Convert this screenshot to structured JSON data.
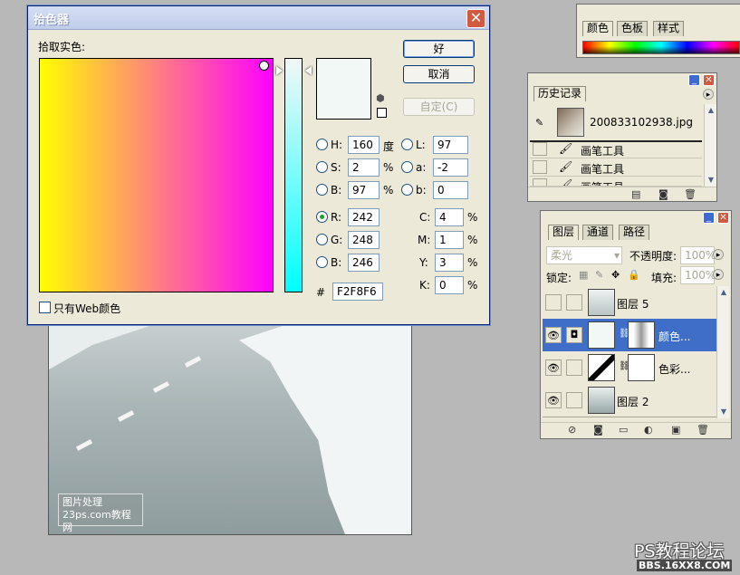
{
  "picker": {
    "title": "拾色器",
    "subtitle": "拾取实色:",
    "buttons": {
      "ok": "好",
      "cancel": "取消",
      "custom": "自定(C)"
    },
    "hsb": [
      {
        "label": "H:",
        "value": "160",
        "unit": "度",
        "selected": false
      },
      {
        "label": "S:",
        "value": "2",
        "unit": "%",
        "selected": false
      },
      {
        "label": "B:",
        "value": "97",
        "unit": "%",
        "selected": false
      }
    ],
    "lab": [
      {
        "label": "L:",
        "value": "97"
      },
      {
        "label": "a:",
        "value": "-2"
      },
      {
        "label": "b:",
        "value": "0"
      }
    ],
    "rgb": [
      {
        "label": "R:",
        "value": "242",
        "selected": true
      },
      {
        "label": "G:",
        "value": "248",
        "selected": false
      },
      {
        "label": "B:",
        "value": "246",
        "selected": false
      }
    ],
    "cmyk": [
      {
        "label": "C:",
        "value": "4",
        "unit": "%"
      },
      {
        "label": "M:",
        "value": "1",
        "unit": "%"
      },
      {
        "label": "Y:",
        "value": "3",
        "unit": "%"
      },
      {
        "label": "K:",
        "value": "0",
        "unit": "%"
      }
    ],
    "hex_label": "#",
    "hex": "F2F8F6",
    "web_only": "只有Web颜色",
    "current_color": "#f2f8f6"
  },
  "color_panel": {
    "tabs": [
      "颜色",
      "色板",
      "样式"
    ]
  },
  "history_panel": {
    "tab": "历史记录",
    "snapshot": "200833102938.jpg",
    "items": [
      "画笔工具",
      "画笔工具",
      "画笔工具"
    ]
  },
  "layers_panel": {
    "tabs": [
      "图层",
      "通道",
      "路径"
    ],
    "blend_mode": "柔光",
    "opacity_label": "不透明度:",
    "opacity": "100%",
    "lock_label": "锁定:",
    "fill_label": "填充:",
    "fill": "100%",
    "layers": [
      "图层 5",
      "颜色...",
      "色彩...",
      "图层 2"
    ]
  },
  "watermark": {
    "line1": "图片处理",
    "line2": "23ps.com教程网"
  },
  "site": {
    "name": "PS教程论坛",
    "url": "BBS.16XX8.COM"
  }
}
